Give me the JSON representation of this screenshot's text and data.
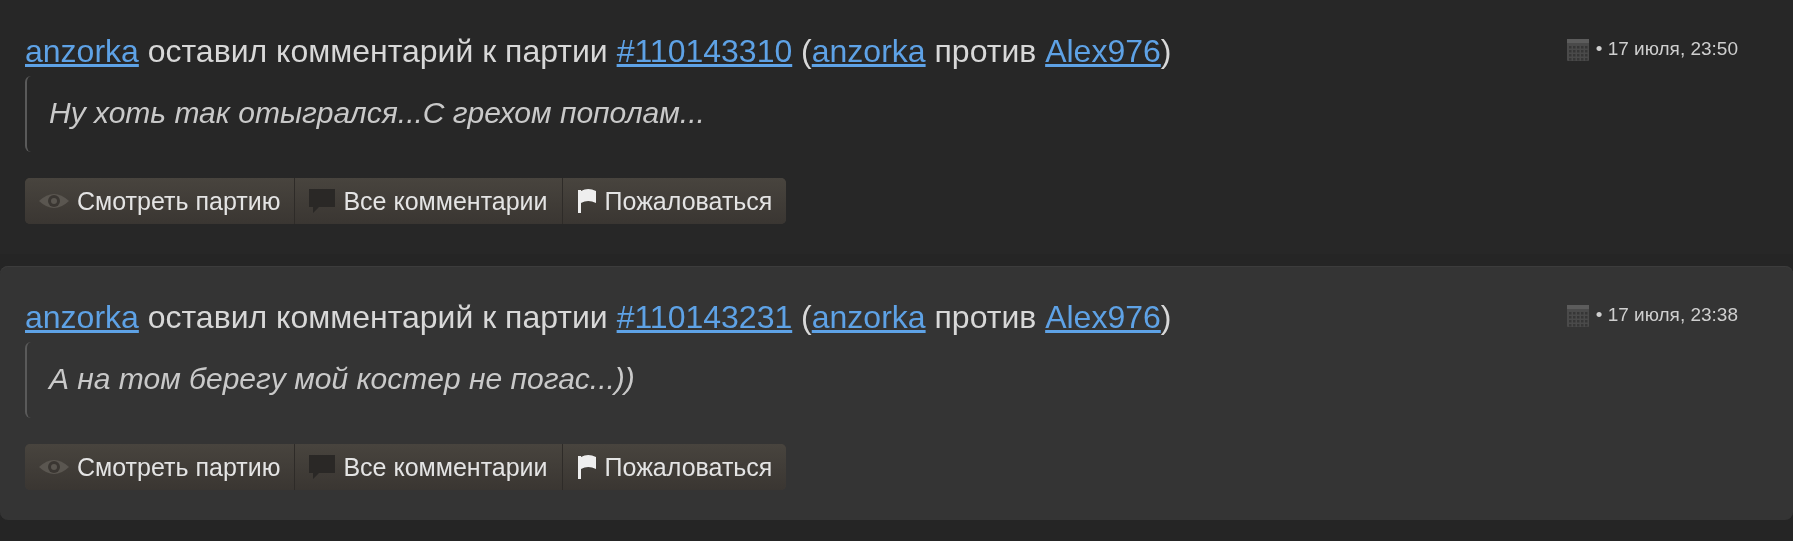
{
  "comments": [
    {
      "highlighted": false,
      "heading": [
        {
          "kind": "link",
          "text": "anzorka"
        },
        {
          "kind": "text",
          "text": " оставил комментарий к партии "
        },
        {
          "kind": "link",
          "text": "#110143310"
        },
        {
          "kind": "text",
          "text": " ("
        },
        {
          "kind": "link",
          "text": "anzorka"
        },
        {
          "kind": "text",
          "text": " против "
        },
        {
          "kind": "link",
          "text": "Alex976"
        },
        {
          "kind": "text",
          "text": ")"
        }
      ],
      "date": "• 17 июля, 23:50",
      "quote": "Ну хоть так отыгрался...С грехом пополам...",
      "actions": [
        {
          "kind": "eye",
          "label": "Смотреть партию"
        },
        {
          "kind": "comments",
          "label": "Все комментарии"
        },
        {
          "kind": "flag",
          "label": "Пожаловаться"
        }
      ]
    },
    {
      "highlighted": true,
      "heading": [
        {
          "kind": "link",
          "text": "anzorka"
        },
        {
          "kind": "text",
          "text": " оставил комментарий к партии "
        },
        {
          "kind": "link",
          "text": "#110143231"
        },
        {
          "kind": "text",
          "text": " ("
        },
        {
          "kind": "link",
          "text": "anzorka"
        },
        {
          "kind": "text",
          "text": " против "
        },
        {
          "kind": "link",
          "text": "Alex976"
        },
        {
          "kind": "text",
          "text": ")"
        }
      ],
      "date": "• 17 июля, 23:38",
      "quote": "А на том берегу мой костер не погас...))",
      "actions": [
        {
          "kind": "eye",
          "label": "Смотреть партию"
        },
        {
          "kind": "comments",
          "label": "Все комментарии"
        },
        {
          "kind": "flag",
          "label": "Пожаловаться"
        }
      ]
    }
  ]
}
